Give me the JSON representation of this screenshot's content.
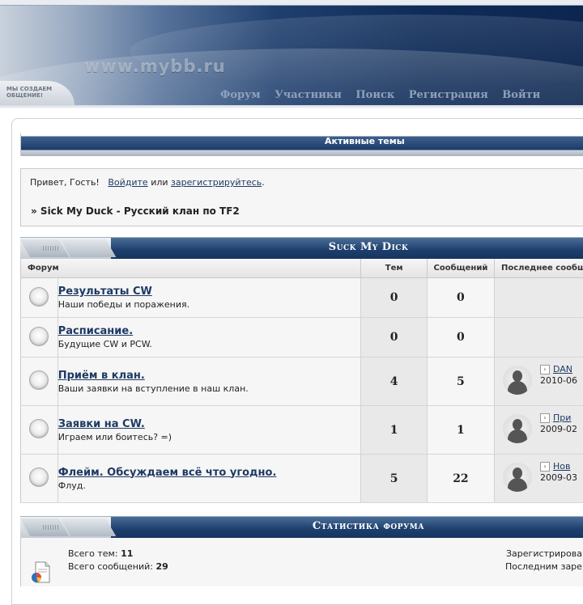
{
  "header": {
    "logo": "www.mybb.ru",
    "badge": "Мы создаем общение!",
    "nav": [
      "Форум",
      "Участники",
      "Поиск",
      "Регистрация",
      "Войти"
    ]
  },
  "active_topics": {
    "label": "Активные темы"
  },
  "welcome": {
    "greeting": "Привет, Гость!",
    "login_link": "Войдите",
    "or": "или",
    "register_link": "зарегистрируйтесь",
    "period": ".",
    "breadcrumb": "» Sick My Duck - Русский клан по TF2"
  },
  "category": {
    "title": "Suck My Dick"
  },
  "table": {
    "headers": {
      "forum": "Форум",
      "topics": "Тем",
      "posts": "Сообщений",
      "last": "Последнее сообщ"
    },
    "rows": [
      {
        "name": "Результаты CW",
        "desc": "Наши победы и поражения.",
        "topics": "0",
        "posts": "0",
        "last_link": "",
        "last_date": ""
      },
      {
        "name": "Расписание.",
        "desc": "Будущие CW и PCW.",
        "topics": "0",
        "posts": "0",
        "last_link": "",
        "last_date": ""
      },
      {
        "name": "Приём в клан.",
        "desc": "Ваши заявки на вступление в наш клан.",
        "topics": "4",
        "posts": "5",
        "last_link": "DAN",
        "last_date": "2010-06"
      },
      {
        "name": "Заявки на CW.",
        "desc": "Играем или боитесь? =)",
        "topics": "1",
        "posts": "1",
        "last_link": "При",
        "last_date": "2009-02"
      },
      {
        "name": "Флейм. Обсуждаем всё что угодно.",
        "desc": "Флуд.",
        "topics": "5",
        "posts": "22",
        "last_link": "Нов",
        "last_date": "2009-03"
      }
    ]
  },
  "stats": {
    "title": "Статистика форума",
    "topics_label": "Всего тем:",
    "topics_value": "11",
    "posts_label": "Всего сообщений:",
    "posts_value": "29",
    "registered": "Зарегистрирова",
    "last_registered": "Последним заре"
  }
}
